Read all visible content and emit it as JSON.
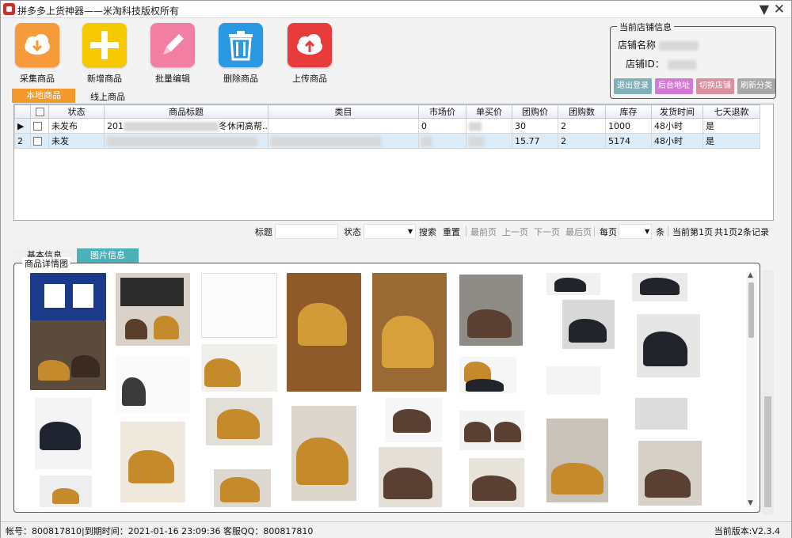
{
  "window": {
    "title": "拼多多上货神器——米淘科技版权所有"
  },
  "toolbar": {
    "buttons": [
      {
        "label": "采集商品",
        "color": "#f79a3b"
      },
      {
        "label": "新增商品",
        "color": "#f5c800"
      },
      {
        "label": "批量编辑",
        "color": "#f27ea3"
      },
      {
        "label": "删除商品",
        "color": "#2a98e3"
      },
      {
        "label": "上传商品",
        "color": "#e83c3c"
      }
    ]
  },
  "store": {
    "legend": "当前店铺信息",
    "name_label": "店铺名称",
    "id_label": "店铺ID：",
    "buttons": [
      {
        "label": "退出登录",
        "color": "#7fb0b8"
      },
      {
        "label": "后台地址",
        "color": "#d27ad3"
      },
      {
        "label": "切换店铺",
        "color": "#d98fa2"
      },
      {
        "label": "刷新分类",
        "color": "#a8a8a8"
      }
    ]
  },
  "tabs": {
    "local": "本地商品",
    "online": "线上商品"
  },
  "grid": {
    "columns": [
      "状态",
      "商品标题",
      "类目",
      "市场价",
      "单买价",
      "团购价",
      "团购数",
      "库存",
      "发货时间",
      "七天退款"
    ],
    "rows": [
      {
        "num": "",
        "status": "未发布",
        "title": "201",
        "title_tail": "冬休闲高帮...",
        "category": "",
        "market": "0",
        "single": "",
        "group_price": "30",
        "group_num": "2",
        "stock": "1000",
        "ship": "48小时",
        "refund": "是"
      },
      {
        "num": "2",
        "status": "未发",
        "title": "",
        "title_tail": "",
        "category": "",
        "market": "",
        "single": "",
        "group_price": "15.77",
        "group_num": "2",
        "stock": "5174",
        "ship": "48小时",
        "refund": "是"
      }
    ]
  },
  "search": {
    "title_label": "标题",
    "status_label": "状态",
    "search_btn": "搜索",
    "reset_btn": "重置",
    "first_page": "最前页",
    "prev_page": "上一页",
    "next_page": "下一页",
    "last_page": "最后页",
    "per_page": "每页",
    "unit": "条",
    "current_page": "当前第1页",
    "summary": "共1页2条记录"
  },
  "detail_tabs": {
    "basic": "基本信息",
    "images": "图片信息"
  },
  "detail": {
    "legend": "商品详情图"
  },
  "status": {
    "left": "帐号：800817810|到期时间：2021-01-16 23:09:36  客服QQ：800817810",
    "version": "当前版本:V2.3.4"
  }
}
